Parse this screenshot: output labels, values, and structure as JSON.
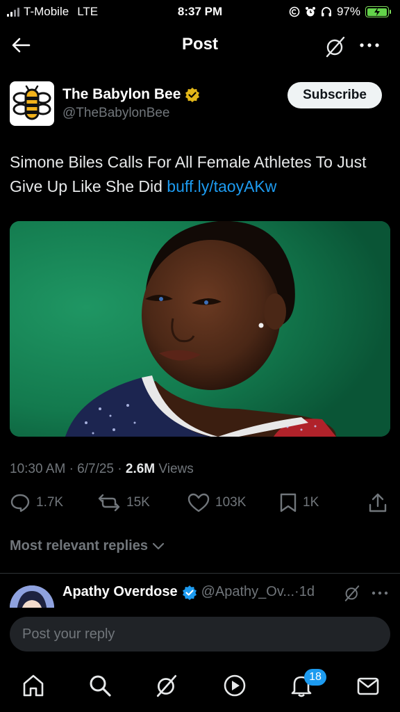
{
  "status_bar": {
    "carrier": "T-Mobile",
    "network": "LTE",
    "time": "8:37 PM",
    "battery": "97%",
    "battery_level": 0.97
  },
  "header": {
    "title": "Post",
    "icons": [
      "back-arrow-icon",
      "grok-icon",
      "more-icon"
    ]
  },
  "post": {
    "author_name": "The Babylon Bee",
    "author_handle": "@TheBabylonBee",
    "subscribe_label": "Subscribe",
    "text": "Simone Biles Calls For All Female Athletes To Just Give Up Like She Did ",
    "link": "buff.ly/taoyAKw",
    "time": "10:30 AM",
    "date": "6/7/25",
    "views_count": "2.6M",
    "views_label": "Views",
    "separator": "·"
  },
  "actions": {
    "replies": "1.7K",
    "reposts": "15K",
    "likes": "103K",
    "bookmarks": "1K"
  },
  "replies_filter": "Most relevant replies",
  "reply_preview": {
    "name": "Apathy Overdose",
    "handle": "@Apathy_Ov...",
    "age": "1d"
  },
  "composer": {
    "placeholder": "Post your reply"
  },
  "bottom_nav": {
    "items": [
      "home-icon",
      "search-icon",
      "grok-icon",
      "video-icon",
      "notifications-icon",
      "messages-icon"
    ],
    "notifications_badge": "18"
  },
  "colors": {
    "accent": "#1d9bf0",
    "verified_gold": "#e2b719",
    "verified_blue": "#1d9bf0",
    "muted": "#71767b"
  }
}
